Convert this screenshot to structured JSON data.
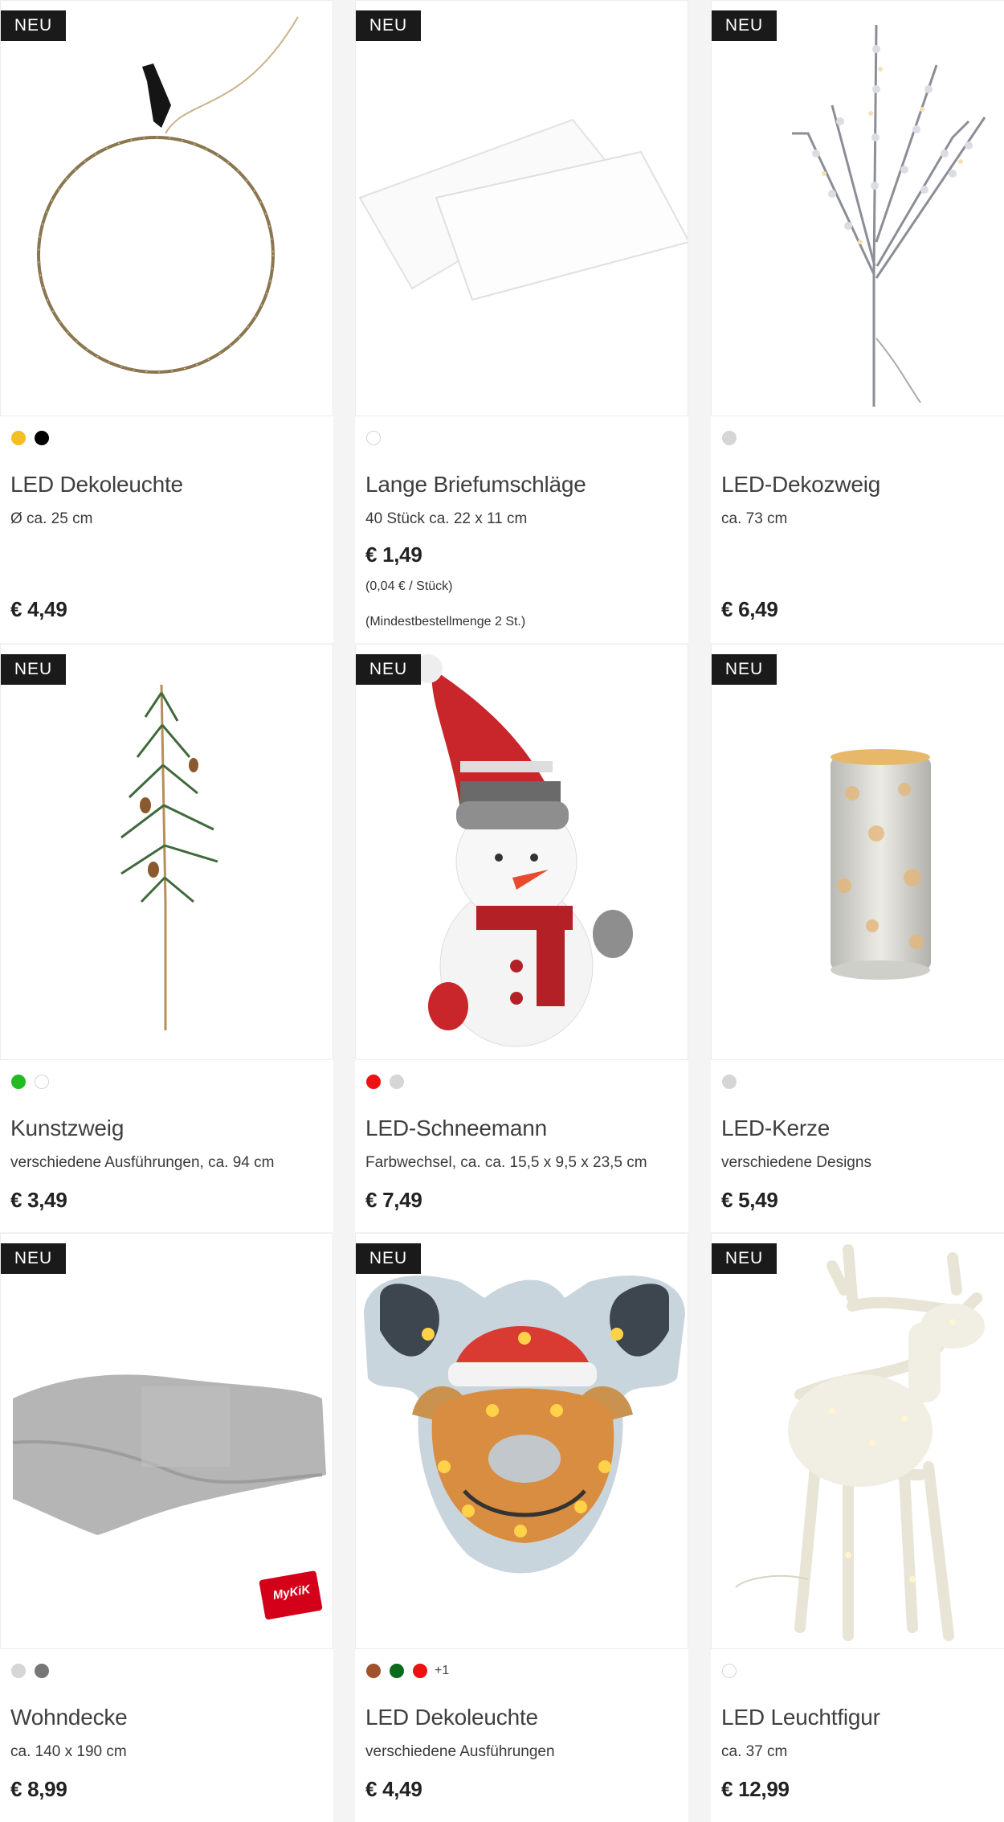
{
  "badge_label": "NEU",
  "products": [
    {
      "title": "LED Dekoleuchte",
      "desc": "Ø ca. 25 cm",
      "price": "€ 4,49",
      "swatches": [
        "#f5be25",
        "#000000"
      ],
      "image": "led-ring-light"
    },
    {
      "title": "Lange Briefumschläge",
      "desc": "40 Stück ca. 22 x 11 cm",
      "price": "€ 1,49",
      "unit_price": "(0,04 € / Stück)",
      "min_order": "(Mindestbestellmenge 2 St.)",
      "swatches": [
        "#ffffff"
      ],
      "image": "envelopes"
    },
    {
      "title": "LED-Dekozweig",
      "desc": "ca. 73 cm",
      "price": "€ 6,49",
      "swatches": [
        "#d6d6d6"
      ],
      "image": "led-branch"
    },
    {
      "title": "Kunstzweig",
      "desc": "verschiedene Ausführungen, ca. 94 cm",
      "price": "€ 3,49",
      "swatches": [
        "#22bb22",
        "#ffffff"
      ],
      "image": "pine-branch"
    },
    {
      "title": "LED-Schneemann",
      "desc": "Farbwechsel, ca. ca. 15,5 x 9,5 x 23,5 cm",
      "price": "€ 7,49",
      "swatches": [
        "#ee1111",
        "#d6d6d6"
      ],
      "image": "snowman"
    },
    {
      "title": "LED-Kerze",
      "desc": "verschiedene Designs",
      "price": "€ 5,49",
      "swatches": [
        "#d6d6d6"
      ],
      "image": "led-candle"
    },
    {
      "title": "Wohndecke",
      "desc": "ca. 140 x 190 cm",
      "price": "€ 8,99",
      "swatches": [
        "#d6d6d6",
        "#777777"
      ],
      "image": "blanket",
      "logo_text": "MyKiK"
    },
    {
      "title": "LED Dekoleuchte",
      "desc": "verschiedene Ausführungen",
      "price": "€ 4,49",
      "swatches": [
        "#a0522d",
        "#0b6b1d",
        "#ee1111"
      ],
      "more_colors": "+1",
      "image": "reindeer-light"
    },
    {
      "title": "LED Leuchtfigur",
      "desc": "ca. 37 cm",
      "price": "€ 12,99",
      "swatches": [
        "#ffffff"
      ],
      "image": "reindeer-figure"
    }
  ]
}
